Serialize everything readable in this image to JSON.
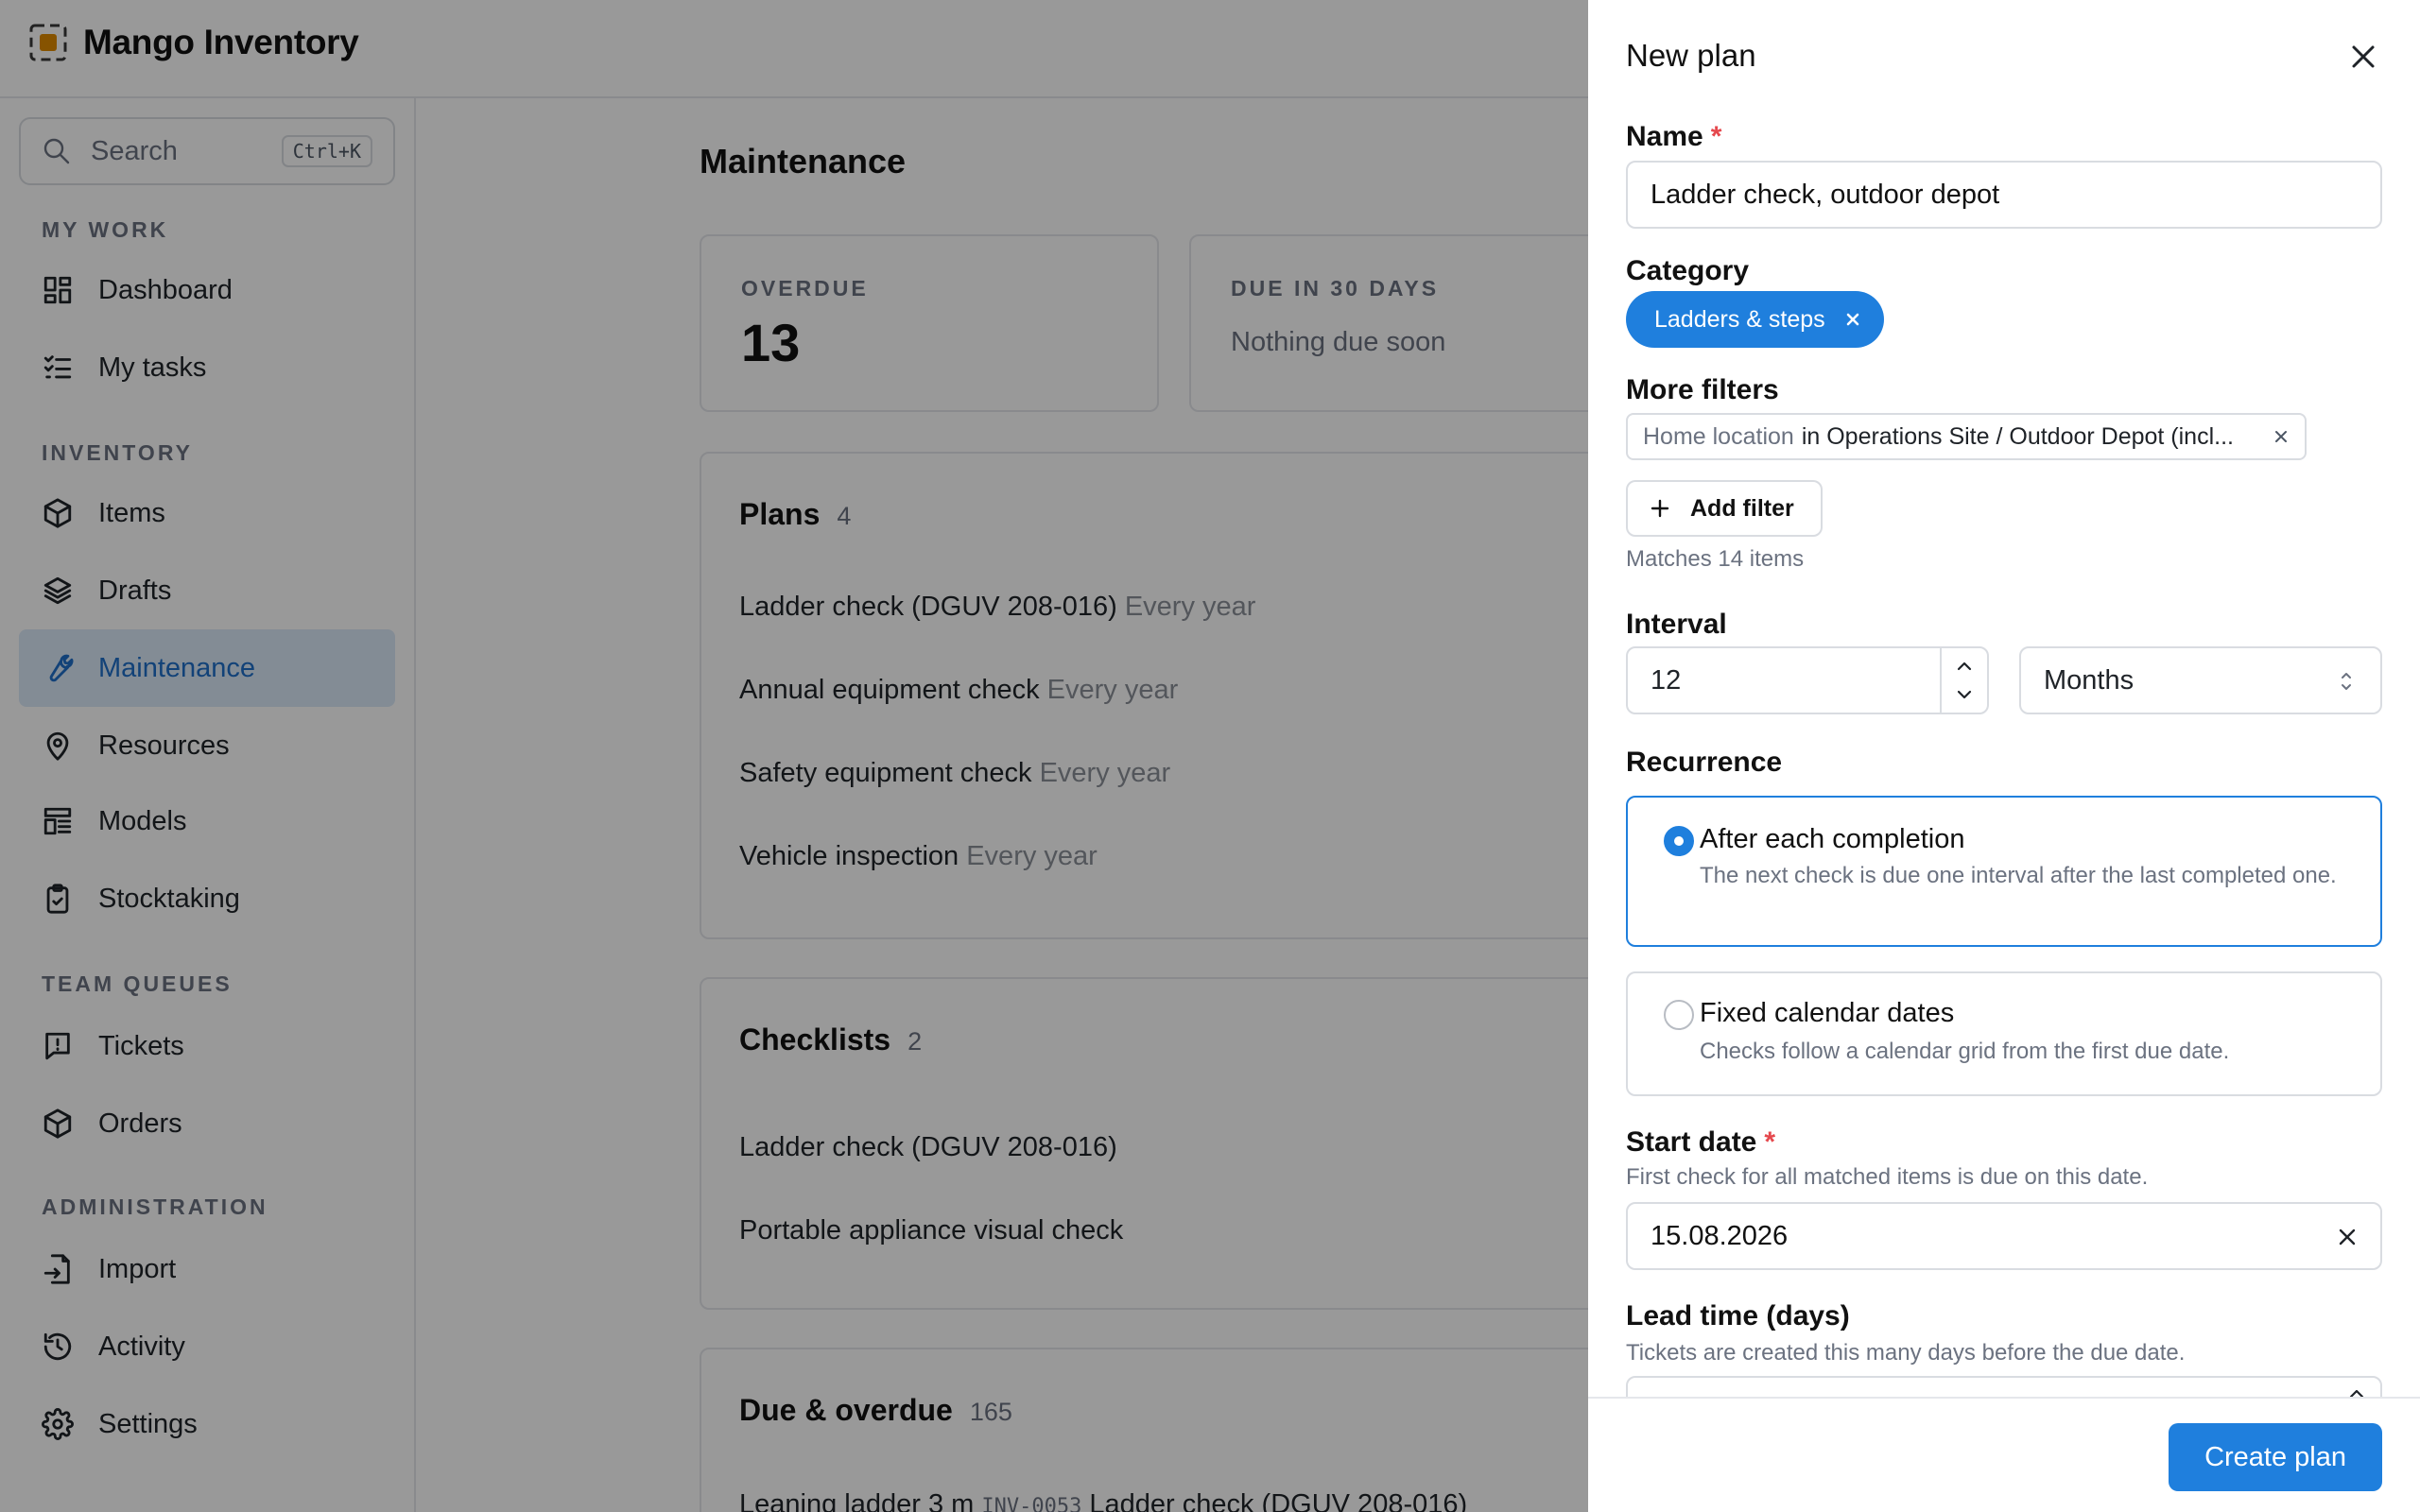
{
  "app": {
    "name": "Mango Inventory",
    "brand_color": "#e08a00"
  },
  "search": {
    "placeholder": "Search",
    "shortcut": "Ctrl+K"
  },
  "sidebar": {
    "sections": [
      {
        "title": "MY WORK"
      },
      {
        "title": "INVENTORY"
      },
      {
        "title": "TEAM QUEUES"
      },
      {
        "title": "ADMINISTRATION"
      }
    ],
    "items": [
      {
        "label": "Dashboard",
        "icon": "dashboard-icon"
      },
      {
        "label": "My tasks",
        "icon": "tasks-icon"
      },
      {
        "label": "Items",
        "icon": "box-icon"
      },
      {
        "label": "Drafts",
        "icon": "layers-icon"
      },
      {
        "label": "Maintenance",
        "icon": "wrench-icon",
        "active": true
      },
      {
        "label": "Resources",
        "icon": "location-pin-icon"
      },
      {
        "label": "Models",
        "icon": "models-icon"
      },
      {
        "label": "Stocktaking",
        "icon": "clipboard-check-icon"
      },
      {
        "label": "Tickets",
        "icon": "ticket-icon"
      },
      {
        "label": "Orders",
        "icon": "box-icon"
      },
      {
        "label": "Import",
        "icon": "import-icon"
      },
      {
        "label": "Activity",
        "icon": "history-icon"
      },
      {
        "label": "Settings",
        "icon": "gear-icon"
      }
    ],
    "active_color": "#1f6fc9"
  },
  "main": {
    "title": "Maintenance",
    "stats": {
      "overdue_label": "OVERDUE",
      "overdue_value": "13",
      "due_label": "DUE IN 30 DAYS",
      "due_text": "Nothing due soon"
    },
    "plans": {
      "title": "Plans",
      "count": "4",
      "rows": [
        {
          "name": "Ladder check (DGUV 208-016)",
          "interval": "Every year"
        },
        {
          "name": "Annual equipment check",
          "interval": "Every year"
        },
        {
          "name": "Safety equipment check",
          "interval": "Every year"
        },
        {
          "name": "Vehicle inspection",
          "interval": "Every year"
        }
      ]
    },
    "checklists": {
      "title": "Checklists",
      "count": "2",
      "rows": [
        {
          "name": "Ladder check (DGUV 208-016)"
        },
        {
          "name": "Portable appliance visual check"
        }
      ]
    },
    "due": {
      "title": "Due & overdue",
      "count": "165",
      "first_row": {
        "item": "Leaning ladder 3 m",
        "code": "INV-0053",
        "plan": "Ladder check (DGUV 208-016)"
      }
    }
  },
  "drawer": {
    "title": "New plan",
    "name": {
      "label": "Name",
      "required_mark": "*",
      "value": "Ladder check, outdoor depot"
    },
    "category": {
      "label": "Category",
      "chip": "Ladders & steps"
    },
    "more_filters": {
      "label": "More filters",
      "filter_key": "Home location",
      "filter_value": "in Operations Site / Outdoor Depot (incl...",
      "add_button": "Add filter",
      "matches": "Matches 14 items"
    },
    "interval": {
      "label": "Interval",
      "value": "12",
      "unit": "Months"
    },
    "recurrence": {
      "label": "Recurrence",
      "options": [
        {
          "title": "After each completion",
          "desc": "The next check is due one interval after the last completed one.",
          "selected": true
        },
        {
          "title": "Fixed calendar dates",
          "desc": "Checks follow a calendar grid from the first due date.",
          "selected": false
        }
      ]
    },
    "start_date": {
      "label": "Start date",
      "required_mark": "*",
      "help": "First check for all matched items is due on this date.",
      "value": "15.08.2026"
    },
    "lead_time": {
      "label": "Lead time (days)",
      "help": "Tickets are created this many days before the due date."
    },
    "submit": "Create plan",
    "accent_color": "#1f7fdd"
  }
}
